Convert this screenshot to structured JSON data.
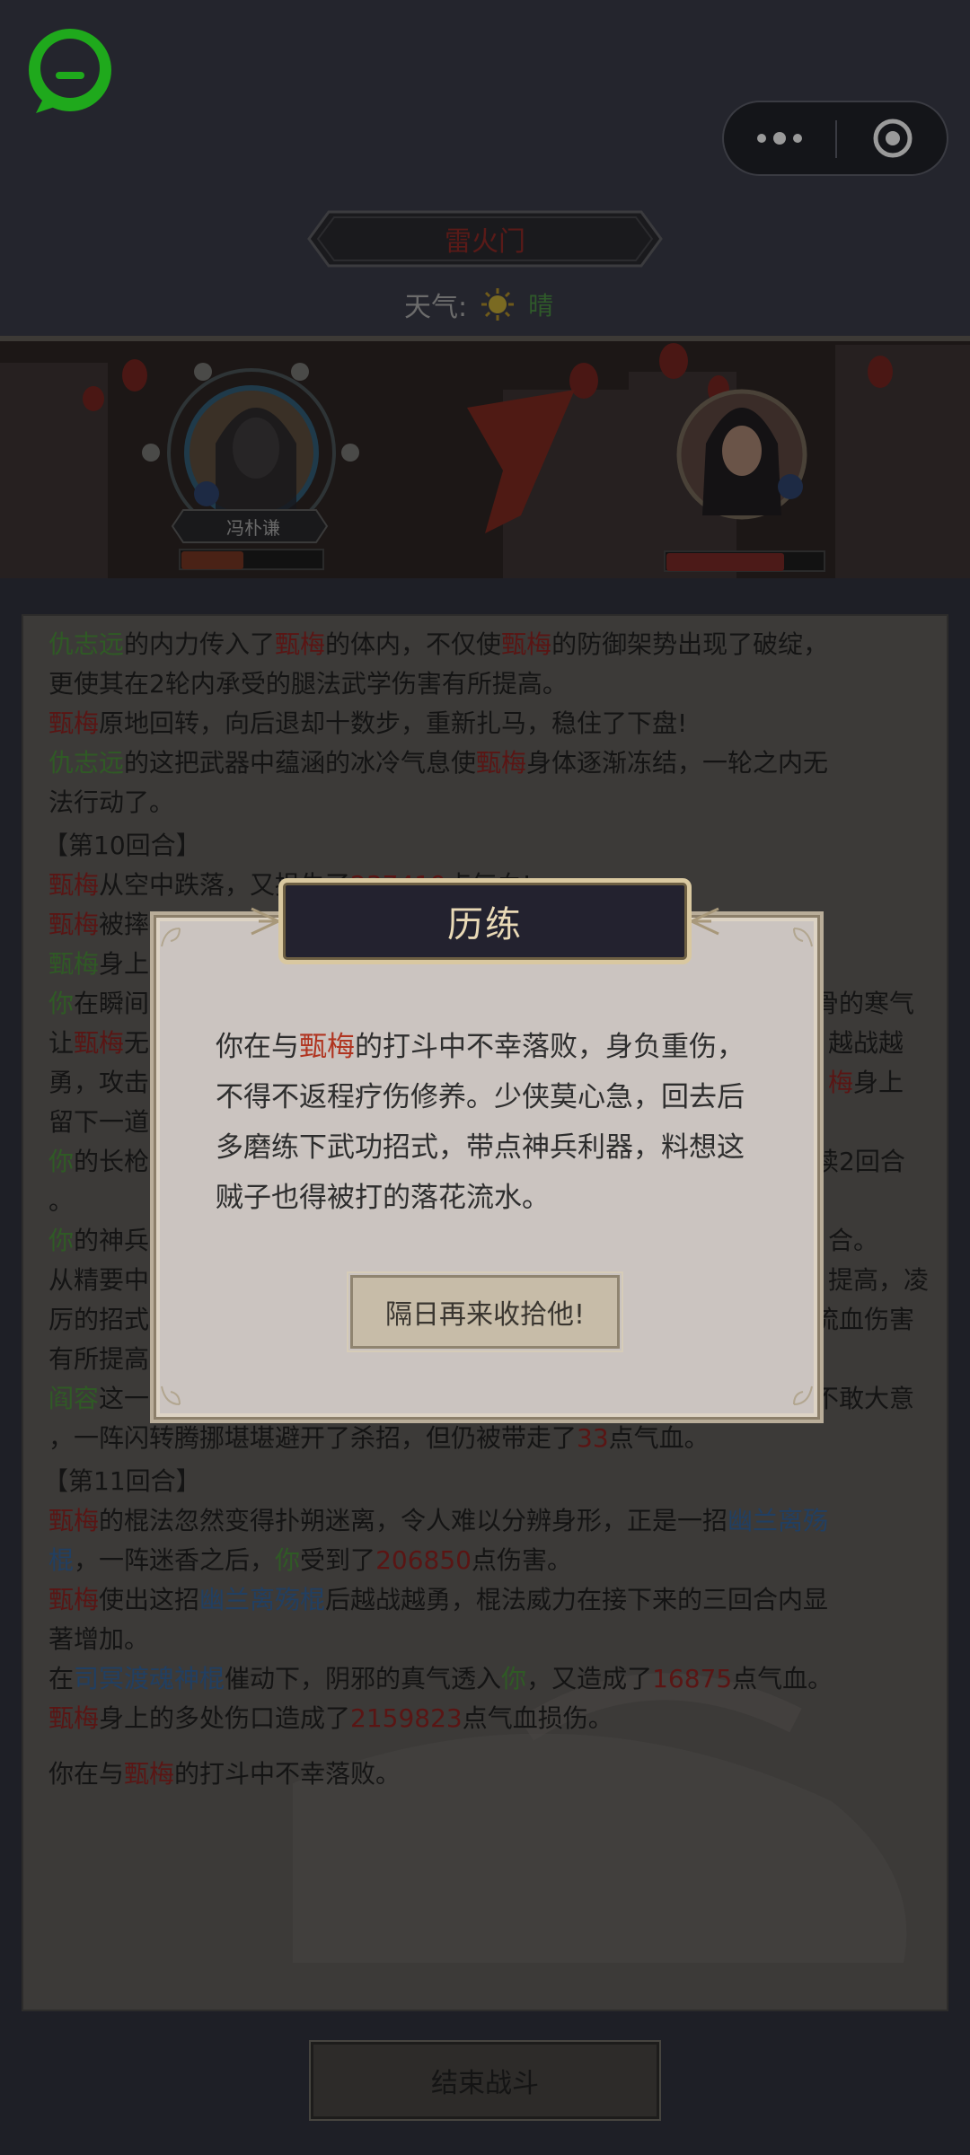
{
  "top": {
    "scene_title": "雷火门",
    "weather_label": "天气:",
    "weather_extra": "晴",
    "icons": {
      "logo": "chat-bubble-logo",
      "more": "more-dots-icon",
      "close": "target-close-icon",
      "weather": "sun-icon"
    }
  },
  "battle": {
    "player_name": "冯朴谦",
    "player_hp": 0.45,
    "enemy_hp": 0.75
  },
  "log": {
    "l1": {
      "a": "仇志远",
      "b": "的内力传入了",
      "c": "甄梅",
      "d": "的体内，不仅使",
      "e": "甄梅",
      "f": "的防御架势出现了破绽，"
    },
    "l2": "更使其在2轮内承受的腿法武学伤害有所提高。",
    "l3": {
      "a": "甄梅",
      "b": "原地回转，向后退却十数步，重新扎马，稳住了下盘!"
    },
    "l4": {
      "a": "仇志远",
      "b": "的这把武器中蕴涵的冰冷气息使",
      "c": "甄梅",
      "d": "身体逐渐冻结，一轮之内无"
    },
    "l5": "法行动了。",
    "l6": "【第10回合】",
    "l7": {
      "a": "甄梅",
      "b": "从空中跌落，",
      "c": "又损失了",
      "d": "237419",
      "e": "点气血!"
    },
    "l8": {
      "a": "甄梅",
      "b": "被摔得着实不"
    },
    "l9": {
      "a": "甄梅",
      "b": "身上"
    },
    "l10": {
      "a": "你",
      "b": "在瞬间",
      "c": "骨的寒气"
    },
    "l11": {
      "a": "让",
      "b": "甄梅",
      "c": "无",
      "d": "",
      "e": "越战越"
    },
    "l12": {
      "a": "勇，攻击",
      "b": "梅",
      "c": "身上"
    },
    "l13": "留下一道",
    "l14": {
      "a": "你",
      "b": "的长枪",
      "c": "续2回合"
    },
    "l15": "。",
    "l16": {
      "a": "你",
      "b": "的神兵",
      "c": "合。"
    },
    "l17": {
      "a": "从精要中",
      "b": "提高，凌"
    },
    "l18": {
      "a": "厉的招式",
      "b": "流血伤害"
    },
    "l19": "有所提高",
    "l20": {
      "a": "阎容",
      "b": "这一",
      "c": "不敢大意"
    },
    "l21": {
      "a": "，一阵闪转腾挪堪堪避开了杀招，但仍被带走了",
      "b": "33",
      "c": "点气血。"
    },
    "l22": "【第11回合】",
    "l23": {
      "a": "甄梅",
      "b": "的棍法忽然变得扑朔迷离，令人难以分辨身形，正是一招",
      "c": "幽兰离殇"
    },
    "l24": {
      "a": "棍",
      "b": "，一阵迷香之后，",
      "c": "你",
      "d": "受到了",
      "e": "206850",
      "f": "点伤害。"
    },
    "l25": {
      "a": "甄梅",
      "b": "使出这招",
      "c": "幽兰离殇棍",
      "d": "后越战越勇，棍法威力在接下来的三回合内显"
    },
    "l26": "著增加。",
    "l27": {
      "a": "在",
      "b": "司冥渡魂神棍",
      "c": "催动下，阴邪的真气透入",
      "d": "你",
      "e": "，又造成了",
      "f": "16875",
      "g": "点气血。"
    },
    "l28": {
      "a": "甄梅",
      "b": "身上的多处伤口造成了",
      "c": "2159823",
      "d": "点气血损伤。"
    },
    "l29": {
      "a": "你在与",
      "b": "甄梅",
      "c": "的打斗中不幸落败。"
    }
  },
  "end_button": "结束战斗",
  "modal": {
    "title": "历练",
    "line1": {
      "a": "你在与",
      "b": "甄梅",
      "c": "的打斗中不幸落败，身负重伤，"
    },
    "line2": "不得不返程疗伤修养。少侠莫心急，回去后",
    "line3": "多磨练下武功招式，带点神兵利器，料想这",
    "line4": "贼子也得被打的落花流水。",
    "button": "隔日再来收拾他!"
  }
}
